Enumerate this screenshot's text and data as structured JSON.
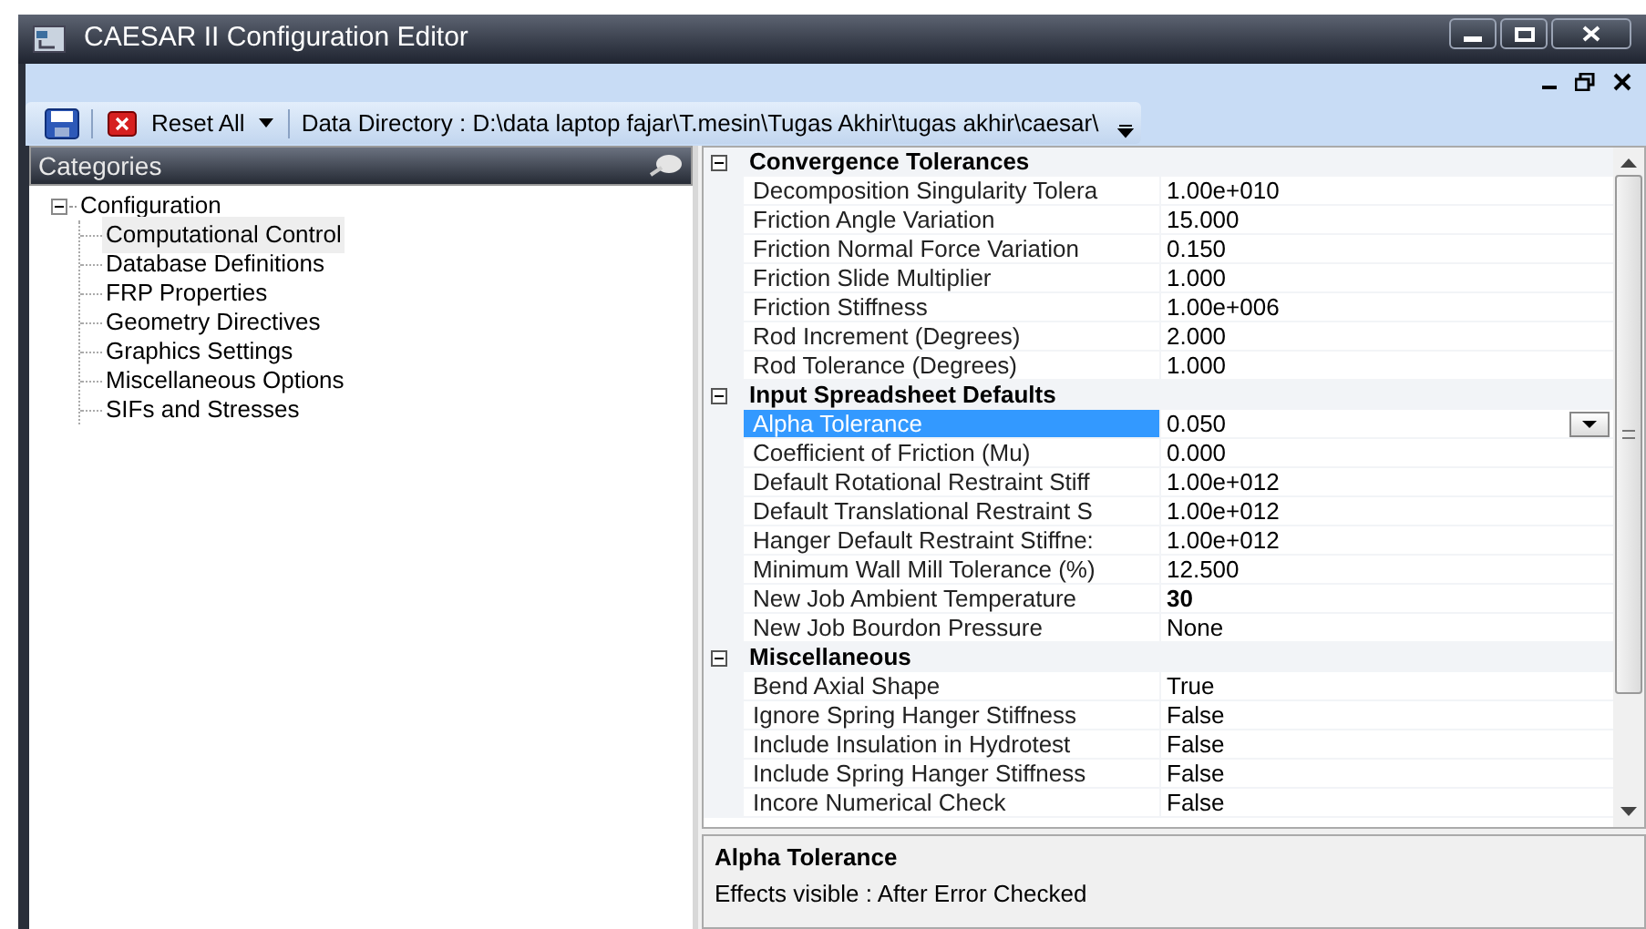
{
  "window": {
    "title": "CAESAR II Configuration Editor"
  },
  "toolbar": {
    "reset_button": {
      "label": "Reset All"
    },
    "data_directory": "Data Directory : D:\\data laptop fajar\\T.mesin\\Tugas Akhir\\tugas akhir\\caesar\\"
  },
  "sidebar": {
    "title": "Categories",
    "tree": [
      {
        "label": "Configuration",
        "expanded": true,
        "children": [
          {
            "label": "Computational Control",
            "selected": true
          },
          {
            "label": "Database Definitions",
            "selected": false
          },
          {
            "label": "FRP Properties",
            "selected": false
          },
          {
            "label": "Geometry Directives",
            "selected": false
          },
          {
            "label": "Graphics Settings",
            "selected": false
          },
          {
            "label": "Miscellaneous Options",
            "selected": false
          },
          {
            "label": "SIFs and Stresses",
            "selected": false
          }
        ]
      }
    ]
  },
  "property_grid": {
    "groups": [
      {
        "title": "Convergence Tolerances",
        "expanded": true,
        "properties": [
          {
            "name": "Decomposition Singularity Tolera",
            "value": "1.00e+010",
            "selected": false,
            "modified": false
          },
          {
            "name": "Friction Angle Variation",
            "value": "15.000",
            "selected": false,
            "modified": false
          },
          {
            "name": "Friction Normal Force Variation",
            "value": "0.150",
            "selected": false,
            "modified": false
          },
          {
            "name": "Friction Slide Multiplier",
            "value": "1.000",
            "selected": false,
            "modified": false
          },
          {
            "name": "Friction Stiffness",
            "value": "1.00e+006",
            "selected": false,
            "modified": false
          },
          {
            "name": "Rod Increment (Degrees)",
            "value": "2.000",
            "selected": false,
            "modified": false
          },
          {
            "name": "Rod Tolerance (Degrees)",
            "value": "1.000",
            "selected": false,
            "modified": false
          }
        ]
      },
      {
        "title": "Input Spreadsheet Defaults",
        "expanded": true,
        "properties": [
          {
            "name": "Alpha Tolerance",
            "value": "0.050",
            "selected": true,
            "modified": false
          },
          {
            "name": "Coefficient of Friction (Mu)",
            "value": "0.000",
            "selected": false,
            "modified": false
          },
          {
            "name": "Default Rotational Restraint Stiff",
            "value": "1.00e+012",
            "selected": false,
            "modified": false
          },
          {
            "name": "Default Translational Restraint S",
            "value": "1.00e+012",
            "selected": false,
            "modified": false
          },
          {
            "name": "Hanger Default Restraint Stiffne:",
            "value": "1.00e+012",
            "selected": false,
            "modified": false
          },
          {
            "name": "Minimum Wall Mill Tolerance (%)",
            "value": "12.500",
            "selected": false,
            "modified": false
          },
          {
            "name": "New Job Ambient Temperature",
            "value": "30",
            "selected": false,
            "modified": true
          },
          {
            "name": "New Job Bourdon Pressure",
            "value": "None",
            "selected": false,
            "modified": false
          }
        ]
      },
      {
        "title": "Miscellaneous",
        "expanded": true,
        "properties": [
          {
            "name": "Bend Axial Shape",
            "value": "True",
            "selected": false,
            "modified": false
          },
          {
            "name": "Ignore Spring Hanger Stiffness",
            "value": "False",
            "selected": false,
            "modified": false
          },
          {
            "name": "Include Insulation in Hydrotest",
            "value": "False",
            "selected": false,
            "modified": false
          },
          {
            "name": "Include Spring Hanger Stiffness",
            "value": "False",
            "selected": false,
            "modified": false
          },
          {
            "name": "Incore Numerical Check",
            "value": "False",
            "selected": false,
            "modified": false
          }
        ]
      }
    ]
  },
  "description": {
    "title": "Alpha Tolerance",
    "text": "Effects visible : After Error Checked"
  }
}
